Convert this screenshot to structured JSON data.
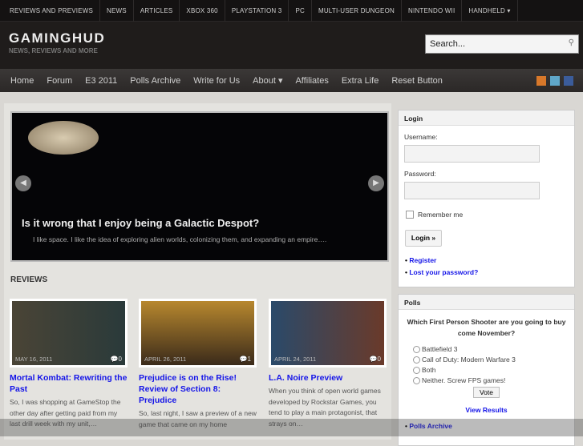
{
  "topbar": [
    "Reviews and Previews",
    "News",
    "Articles",
    "Xbox 360",
    "Playstation 3",
    "PC",
    "Multi-User Dungeon",
    "Nintendo Wii",
    "Handheld ▾"
  ],
  "header": {
    "logo": "GAMINGHUD",
    "tagline": "NEWS, REVIEWS AND MORE",
    "search_placeholder": "Search..."
  },
  "nav": [
    "Home",
    "Forum",
    "E3 2011",
    "Polls Archive",
    "Write for Us",
    "About ▾",
    "Affiliates",
    "Extra Life",
    "Reset Button"
  ],
  "slider": {
    "title": "Is it wrong that I enjoy being a Galactic Despot?",
    "excerpt": "I like space. I like the idea of exploring alien worlds, colonizing them, and expanding an empire…."
  },
  "reviews": {
    "heading": "REVIEWS",
    "items": [
      {
        "title": "Mortal Kombat: Rewriting the Past",
        "date": "MAY 16, 2011",
        "comments": "0",
        "excerpt": "So, I was shopping at GameStop the other day after getting paid from my last drill week with my unit,…"
      },
      {
        "title": "Prejudice is on the Rise! Review of Section 8: Prejudice",
        "date": "APRIL 26, 2011",
        "comments": "1",
        "excerpt": "So, last night, I saw a preview of a new game that came on my home"
      },
      {
        "title": "L.A. Noire Preview",
        "date": "APRIL 24, 2011",
        "comments": "0",
        "excerpt": "When you think of open world games developed by Rockstar Games, you tend to play a main protagonist, that strays on…"
      }
    ]
  },
  "login": {
    "title": "Login",
    "username": "Username:",
    "password": "Password:",
    "remember": "Remember me",
    "button": "Login »",
    "links": [
      "Register",
      "Lost your password?"
    ]
  },
  "polls": {
    "title": "Polls",
    "question": "Which First Person Shooter are you going to buy come November?",
    "options": [
      "Battlefield 3",
      "Call of Duty: Modern Warfare 3",
      "Both",
      "Neither. Screw FPS games!"
    ],
    "vote": "Vote",
    "results": "View Results",
    "archive": "Polls Archive"
  }
}
